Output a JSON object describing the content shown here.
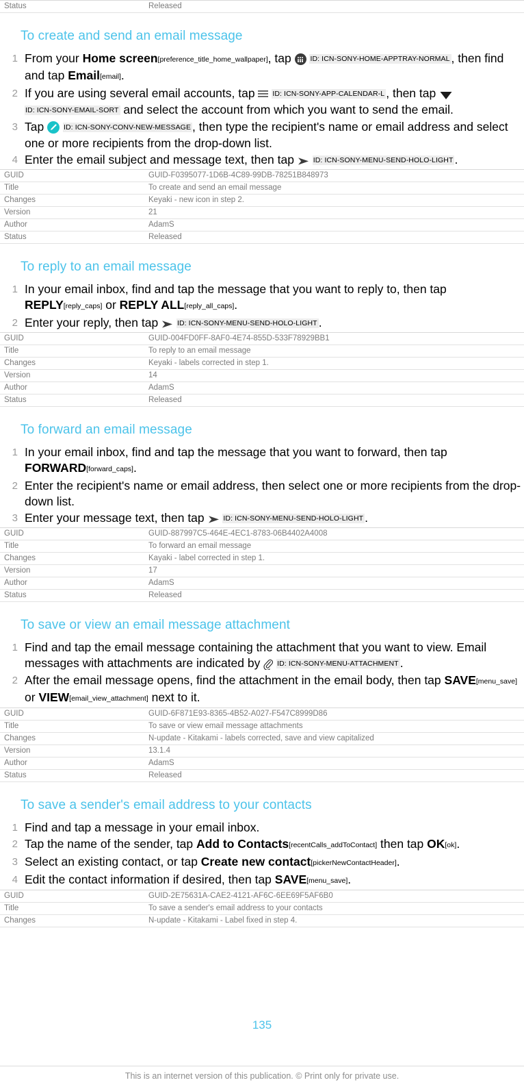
{
  "top_status_row": {
    "key": "Status",
    "value": "Released"
  },
  "meta_headers": [
    "GUID",
    "Title",
    "Changes",
    "Version",
    "Author",
    "Status"
  ],
  "sections": [
    {
      "heading": "To create and send an email message",
      "steps": [
        {
          "number": "1",
          "parts": [
            {
              "t": "text",
              "v": "From your "
            },
            {
              "t": "ui",
              "v": "Home screen"
            },
            {
              "t": "tok",
              "v": "[preference_title_home_wallpaper]"
            },
            {
              "t": "text",
              "v": ", tap "
            },
            {
              "t": "icon",
              "v": "apptray-icon"
            },
            {
              "t": "idtag",
              "v": "ID: ICN-SONY-HOME-APPTRAY-NORMAL"
            },
            {
              "t": "text",
              "v": ", then find and tap "
            },
            {
              "t": "ui",
              "v": "Email"
            },
            {
              "t": "tok",
              "v": "[email]"
            },
            {
              "t": "text",
              "v": "."
            }
          ]
        },
        {
          "number": "2",
          "parts": [
            {
              "t": "text",
              "v": "If you are using several email accounts, tap "
            },
            {
              "t": "icon",
              "v": "hamburger-menu-icon"
            },
            {
              "t": "idtag",
              "v": "ID: ICN-SONY-APP-CALENDAR-L"
            },
            {
              "t": "text",
              "v": ", then tap "
            },
            {
              "t": "icon",
              "v": "caret-down-icon"
            },
            {
              "t": "idtag",
              "v": "ID: ICN-SONY-EMAIL-SORT"
            },
            {
              "t": "text",
              "v": " and select the account from which you want to send the email."
            }
          ]
        },
        {
          "number": "3",
          "parts": [
            {
              "t": "text",
              "v": "Tap "
            },
            {
              "t": "icon",
              "v": "compose-pencil-icon"
            },
            {
              "t": "idtag",
              "v": "ID: ICN-SONY-CONV-NEW-MESSAGE"
            },
            {
              "t": "text",
              "v": ", then type the recipient's name or email address and select one or more recipients from the drop-down list."
            }
          ]
        },
        {
          "number": "4",
          "parts": [
            {
              "t": "text",
              "v": "Enter the email subject and message text, then tap "
            },
            {
              "t": "icon",
              "v": "send-arrow-icon"
            },
            {
              "t": "idtag",
              "v": "ID: ICN-SONY-MENU-SEND-HOLO-LIGHT"
            },
            {
              "t": "text",
              "v": "."
            }
          ]
        }
      ],
      "meta": {
        "GUID": "GUID-F0395077-1D6B-4C89-99DB-78251B848973",
        "Title": "To create and send an email message",
        "Changes": "Keyaki - new icon in step 2.",
        "Version": "21",
        "Author": "AdamS",
        "Status": "Released"
      }
    },
    {
      "heading": "To reply to an email message",
      "steps": [
        {
          "number": "1",
          "parts": [
            {
              "t": "text",
              "v": "In your email inbox, find and tap the message that you want to reply to, then tap "
            },
            {
              "t": "ui",
              "v": "REPLY"
            },
            {
              "t": "tok",
              "v": "[reply_caps]"
            },
            {
              "t": "text",
              "v": " or "
            },
            {
              "t": "ui",
              "v": "REPLY ALL"
            },
            {
              "t": "tok",
              "v": "[reply_all_caps]"
            },
            {
              "t": "text",
              "v": "."
            }
          ]
        },
        {
          "number": "2",
          "parts": [
            {
              "t": "text",
              "v": "Enter your reply, then tap "
            },
            {
              "t": "icon",
              "v": "send-arrow-icon"
            },
            {
              "t": "idtag",
              "v": "ID: ICN-SONY-MENU-SEND-HOLO-LIGHT"
            },
            {
              "t": "text",
              "v": "."
            }
          ]
        }
      ],
      "meta": {
        "GUID": "GUID-004FD0FF-8AF0-4E74-855D-533F78929BB1",
        "Title": "To reply to an email message",
        "Changes": "Keyaki - labels corrected in step 1.",
        "Version": "14",
        "Author": "AdamS",
        "Status": "Released"
      }
    },
    {
      "heading": "To forward an email message",
      "steps": [
        {
          "number": "1",
          "parts": [
            {
              "t": "text",
              "v": "In your email inbox, find and tap the message that you want to forward, then tap "
            },
            {
              "t": "ui",
              "v": "FORWARD"
            },
            {
              "t": "tok",
              "v": "[forward_caps]"
            },
            {
              "t": "text",
              "v": "."
            }
          ]
        },
        {
          "number": "2",
          "parts": [
            {
              "t": "text",
              "v": "Enter the recipient's name or email address, then select one or more recipients from the drop-down list."
            }
          ]
        },
        {
          "number": "3",
          "parts": [
            {
              "t": "text",
              "v": "Enter your message text, then tap "
            },
            {
              "t": "icon",
              "v": "send-arrow-icon"
            },
            {
              "t": "idtag",
              "v": "ID: ICN-SONY-MENU-SEND-HOLO-LIGHT"
            },
            {
              "t": "text",
              "v": "."
            }
          ]
        }
      ],
      "meta": {
        "GUID": "GUID-887997C5-464E-4EC1-8783-06B4402A4008",
        "Title": "To forward an email message",
        "Changes": "Kayaki - label corrected in step 1.",
        "Version": "17",
        "Author": "AdamS",
        "Status": "Released"
      }
    },
    {
      "heading": "To save or view an email message attachment",
      "steps": [
        {
          "number": "1",
          "parts": [
            {
              "t": "text",
              "v": "Find and tap the email message containing the attachment that you want to view. Email messages with attachments are indicated by "
            },
            {
              "t": "icon",
              "v": "paperclip-icon"
            },
            {
              "t": "idtag",
              "v": "ID: ICN-SONY-MENU-ATTACHMENT"
            },
            {
              "t": "text",
              "v": "."
            }
          ]
        },
        {
          "number": "2",
          "parts": [
            {
              "t": "text",
              "v": "After the email message opens, find the attachment in the email body, then tap "
            },
            {
              "t": "ui",
              "v": "SAVE"
            },
            {
              "t": "tok",
              "v": "[menu_save]"
            },
            {
              "t": "text",
              "v": " or "
            },
            {
              "t": "ui",
              "v": "VIEW"
            },
            {
              "t": "tok",
              "v": "[email_view_attachment]"
            },
            {
              "t": "text",
              "v": " next to it."
            }
          ]
        }
      ],
      "meta": {
        "GUID": "GUID-6F871E93-8365-4B52-A027-F547C8999D86",
        "Title": "To save or view email message attachments",
        "Changes": "N-update - Kitakami - labels corrected, save and view capitalized",
        "Version": "13.1.4",
        "Author": "AdamS",
        "Status": "Released"
      }
    },
    {
      "heading": "To save a sender's email address to your contacts",
      "steps": [
        {
          "number": "1",
          "parts": [
            {
              "t": "text",
              "v": "Find and tap a message in your email inbox."
            }
          ]
        },
        {
          "number": "2",
          "parts": [
            {
              "t": "text",
              "v": "Tap the name of the sender, tap "
            },
            {
              "t": "ui",
              "v": "Add to Contacts"
            },
            {
              "t": "tok",
              "v": "[recentCalls_addToContact]"
            },
            {
              "t": "text",
              "v": " then tap "
            },
            {
              "t": "ui",
              "v": "OK"
            },
            {
              "t": "tok",
              "v": "[ok]"
            },
            {
              "t": "text",
              "v": "."
            }
          ]
        },
        {
          "number": "3",
          "parts": [
            {
              "t": "text",
              "v": "Select an existing contact, or tap "
            },
            {
              "t": "ui",
              "v": "Create new contact"
            },
            {
              "t": "tok",
              "v": "[pickerNewContactHeader]"
            },
            {
              "t": "text",
              "v": "."
            }
          ]
        },
        {
          "number": "4",
          "parts": [
            {
              "t": "text",
              "v": "Edit the contact information if desired, then tap "
            },
            {
              "t": "ui",
              "v": "SAVE"
            },
            {
              "t": "tok",
              "v": "[menu_save]"
            },
            {
              "t": "text",
              "v": "."
            }
          ]
        }
      ],
      "meta": {
        "GUID": "GUID-2E75631A-CAE2-4121-AF6C-6EE69F5AF6B0",
        "Title": "To save a sender's email address to your contacts",
        "Changes": "N-update - Kitakami - Label fixed in step 4."
      }
    }
  ],
  "page_number": "135",
  "footer_text": "This is an internet version of this publication. © Print only for private use.",
  "colors": {
    "heading": "#4cc3ea",
    "folio": "#4cc3ea",
    "meta_text": "#7c7c7c",
    "step_number": "#9b9b9b",
    "idtag_bg": "#ededed",
    "compose_icon": "#19c3c9",
    "apptray_icon": "#3a3a3a"
  }
}
